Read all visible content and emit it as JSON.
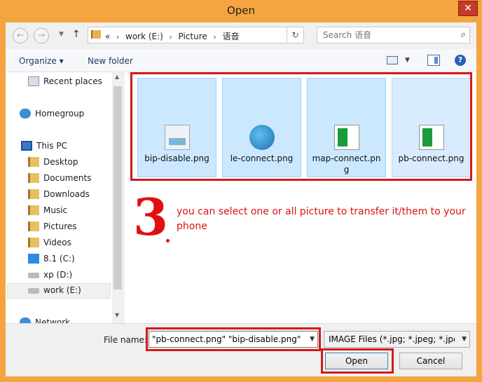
{
  "window": {
    "title": "Open",
    "close_glyph": "✕"
  },
  "nav": {
    "back_glyph": "←",
    "forward_glyph": "→",
    "up_glyph": "↑",
    "refresh_glyph": "↻",
    "address": {
      "overflow": "«",
      "crumbs": [
        "work (E:)",
        "Picture",
        "语音"
      ]
    },
    "search": {
      "placeholder": "Search 语音",
      "icon": "search-icon"
    }
  },
  "toolbar": {
    "organize_label": "Organize ▾",
    "new_folder_label": "New folder",
    "help_glyph": "?"
  },
  "sidebar": {
    "items": [
      {
        "label": "Recent places",
        "icon": "recent-places-icon"
      },
      {
        "label": "Homegroup",
        "icon": "homegroup-icon"
      },
      {
        "label": "This PC",
        "icon": "computer-icon"
      },
      {
        "label": "Desktop",
        "icon": "folder-icon"
      },
      {
        "label": "Documents",
        "icon": "folder-icon"
      },
      {
        "label": "Downloads",
        "icon": "folder-icon"
      },
      {
        "label": "Music",
        "icon": "folder-icon"
      },
      {
        "label": "Pictures",
        "icon": "folder-icon"
      },
      {
        "label": "Videos",
        "icon": "folder-icon"
      },
      {
        "label": "8.1 (C:)",
        "icon": "windows-drive-icon"
      },
      {
        "label": "xp (D:)",
        "icon": "drive-icon"
      },
      {
        "label": "work (E:)",
        "icon": "drive-icon",
        "selected": true
      },
      {
        "label": "Network",
        "icon": "network-icon"
      }
    ]
  },
  "files": [
    {
      "name": "bip-disable.png",
      "icon": "image-file-icon",
      "selected": true
    },
    {
      "name": "le-connect.png",
      "icon": "globe-file-icon",
      "selected": true
    },
    {
      "name": "map-connect.png",
      "icon": "document-file-icon",
      "selected": true
    },
    {
      "name": "pb-connect.png",
      "icon": "document-file-icon",
      "selected": true
    }
  ],
  "annotation": {
    "number": "3",
    "text": "you can select one or all picture to transfer it/them to your phone",
    "color": "#e01010"
  },
  "footer": {
    "file_name_label": "File name:",
    "file_name_value": "\"pb-connect.png\" \"bip-disable.png\"",
    "file_type": "IMAGE Files (*.jpg; *.jpeg; *.jpe;",
    "open_label": "Open",
    "cancel_label": "Cancel"
  },
  "colors": {
    "title_bar": "#f4a53f",
    "selection": "#cce8ff",
    "highlight": "#d41a1a"
  }
}
